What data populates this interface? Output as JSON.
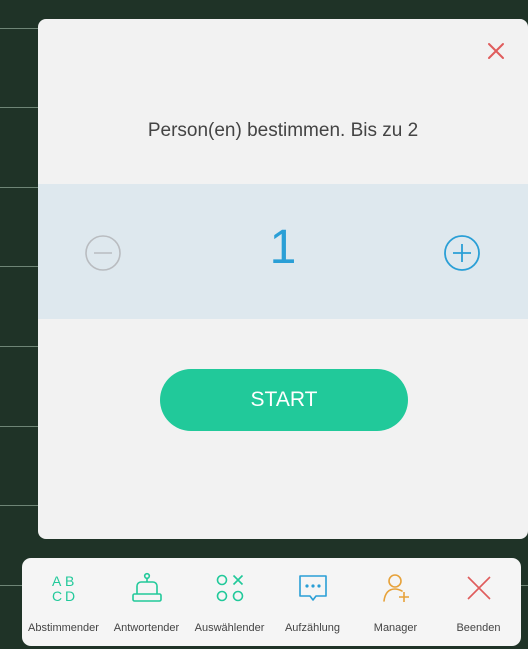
{
  "dialog": {
    "title": "Person(en) bestimmen. Bis zu 2",
    "count": "1",
    "start_label": "START"
  },
  "toolbar": {
    "items": [
      {
        "label": "Abstimmender",
        "icon": "abcd-icon"
      },
      {
        "label": "Antwortender",
        "icon": "bell-icon"
      },
      {
        "label": "Auswählender",
        "icon": "random-select-icon"
      },
      {
        "label": "Aufzählung",
        "icon": "chat-list-icon"
      },
      {
        "label": "Manager",
        "icon": "add-user-icon"
      },
      {
        "label": "Beenden",
        "icon": "close-icon"
      }
    ]
  },
  "colors": {
    "accent_blue": "#2a9fd6",
    "start_green": "#21c99a",
    "close_red": "#e05c5c",
    "manager_orange": "#e7a23a",
    "tool_green": "#21c99a",
    "background": "#1f3327"
  }
}
